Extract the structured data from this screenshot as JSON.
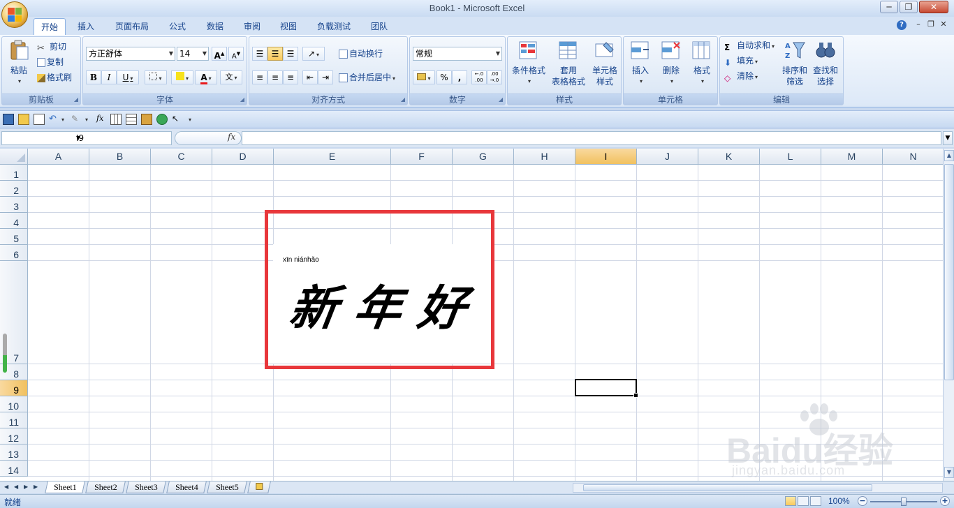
{
  "window": {
    "title": "Book1 - Microsoft Excel",
    "minimize": "─",
    "maximize": "❐",
    "close": "✕"
  },
  "tabs": [
    "开始",
    "插入",
    "页面布局",
    "公式",
    "数据",
    "审阅",
    "视图",
    "负载测试",
    "团队"
  ],
  "mdi": {
    "help": "?",
    "min": "–",
    "restore": "❐",
    "close": "✕"
  },
  "ribbon": {
    "clipboard": {
      "label": "剪贴板",
      "paste": "粘贴",
      "cut": "剪切",
      "copy": "复制",
      "format_painter": "格式刷"
    },
    "font": {
      "label": "字体",
      "family": "方正舒体",
      "size": "14",
      "grow": "A",
      "shrink": "A",
      "bold": "B",
      "italic": "I",
      "underline": "U",
      "phonetic": "文"
    },
    "alignment": {
      "label": "对齐方式",
      "wrap": "自动换行",
      "merge": "合并后居中"
    },
    "number": {
      "label": "数字",
      "format": "常规",
      "percent": "%",
      "comma": ",",
      "inc": "←.0 .00",
      "dec": ".00 →.0"
    },
    "styles": {
      "label": "样式",
      "conditional": [
        "条件格式"
      ],
      "table": [
        "套用",
        "表格格式"
      ],
      "cell": [
        "单元格",
        "样式"
      ]
    },
    "cells": {
      "label": "单元格",
      "insert": "插入",
      "delete": "删除",
      "format": "格式"
    },
    "editing": {
      "label": "编辑",
      "autosum": "自动求和",
      "fill": "填充",
      "clear": "清除",
      "sort": [
        "排序和",
        "筛选"
      ],
      "find": [
        "查找和",
        "选择"
      ]
    }
  },
  "namebox": "I9",
  "fx": "fx",
  "columns": [
    {
      "name": "A"
    },
    {
      "name": "B"
    },
    {
      "name": "C"
    },
    {
      "name": "D"
    },
    {
      "name": "E"
    },
    {
      "name": "F"
    },
    {
      "name": "G"
    },
    {
      "name": "H"
    },
    {
      "name": "I",
      "selected": true
    },
    {
      "name": "J"
    },
    {
      "name": "K"
    },
    {
      "name": "L"
    },
    {
      "name": "M"
    },
    {
      "name": "N"
    }
  ],
  "rows": [
    {
      "label": "1"
    },
    {
      "label": "2"
    },
    {
      "label": "3"
    },
    {
      "label": "4"
    },
    {
      "label": "5"
    },
    {
      "label": "6"
    },
    {
      "label": "7"
    },
    {
      "label": "8"
    },
    {
      "label": "9",
      "selected": true
    },
    {
      "label": "10"
    },
    {
      "label": "11"
    },
    {
      "label": "12"
    },
    {
      "label": "13"
    },
    {
      "label": "14"
    }
  ],
  "cell_content": {
    "pinyin": "xīn niánhǎo",
    "text": "新年好"
  },
  "highlight_color": "#e8373b",
  "sheets": [
    "Sheet1",
    "Sheet2",
    "Sheet3",
    "Sheet4",
    "Sheet5"
  ],
  "status": {
    "ready": "就绪",
    "zoom": "100%"
  },
  "watermark": {
    "brand": "Baidu经验",
    "url": "jingyan.baidu.com"
  }
}
